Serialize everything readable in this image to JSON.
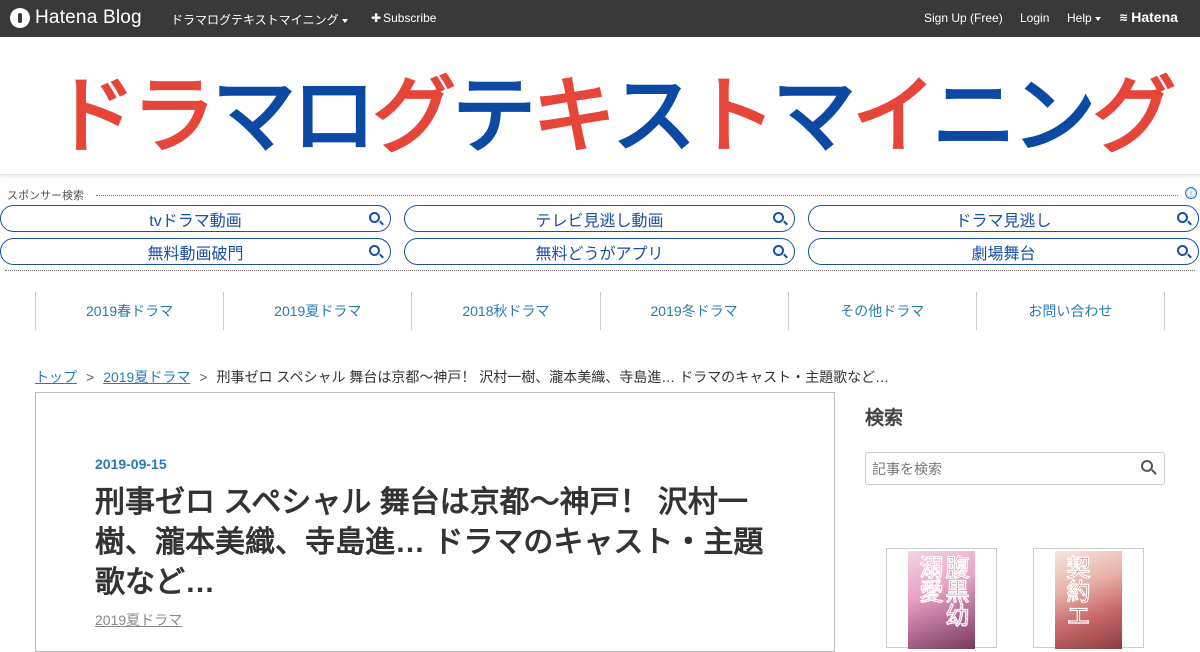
{
  "topbar": {
    "logo_text": "Hatena Blog",
    "blog_name": "ドラマログテキストマイニング",
    "subscribe": "Subscribe",
    "signup": "Sign Up (Free)",
    "login": "Login",
    "help": "Help",
    "hatena": "Hatena"
  },
  "banner": {
    "title_chars": [
      "ド",
      "ラ",
      "マ",
      "ロ",
      "グ",
      "テ",
      "キ",
      "ス",
      "ト",
      "マ",
      "イ",
      "ニ",
      "ン",
      "グ"
    ],
    "colors": {
      "red": "#e6463a",
      "blue": "#0b49a3"
    }
  },
  "sponsor": {
    "label": "スポンサー検索",
    "info_icon": "ⓘ",
    "links": [
      "tvドラマ動画",
      "テレビ見逃し動画",
      "ドラマ見逃し",
      "無料動画破門",
      "無料どうがアプリ",
      "劇場舞台"
    ]
  },
  "categories": [
    "2019春ドラマ",
    "2019夏ドラマ",
    "2018秋ドラマ",
    "2019冬ドラマ",
    "その他ドラマ",
    "お問い合わせ"
  ],
  "breadcrumb": {
    "top": "トップ",
    "sep": ">",
    "category": "2019夏ドラマ",
    "current": "刑事ゼロ スペシャル 舞台は京都～神戸！ 沢村一樹、瀧本美織、寺島進… ドラマのキャスト・主題歌など…"
  },
  "article": {
    "date": "2019-09-15",
    "title": "刑事ゼロ スペシャル 舞台は京都～神戸！ 沢村一樹、瀧本美織、寺島進… ドラマのキャスト・主題歌など…",
    "category": "2019夏ドラマ"
  },
  "sidebar": {
    "search_title": "検索",
    "search_placeholder": "記事を検索",
    "books": [
      {
        "cover_text": "腹黒幼溺愛"
      },
      {
        "cover_text": "契約エ"
      }
    ]
  },
  "accent_color": "#2a7bb4"
}
